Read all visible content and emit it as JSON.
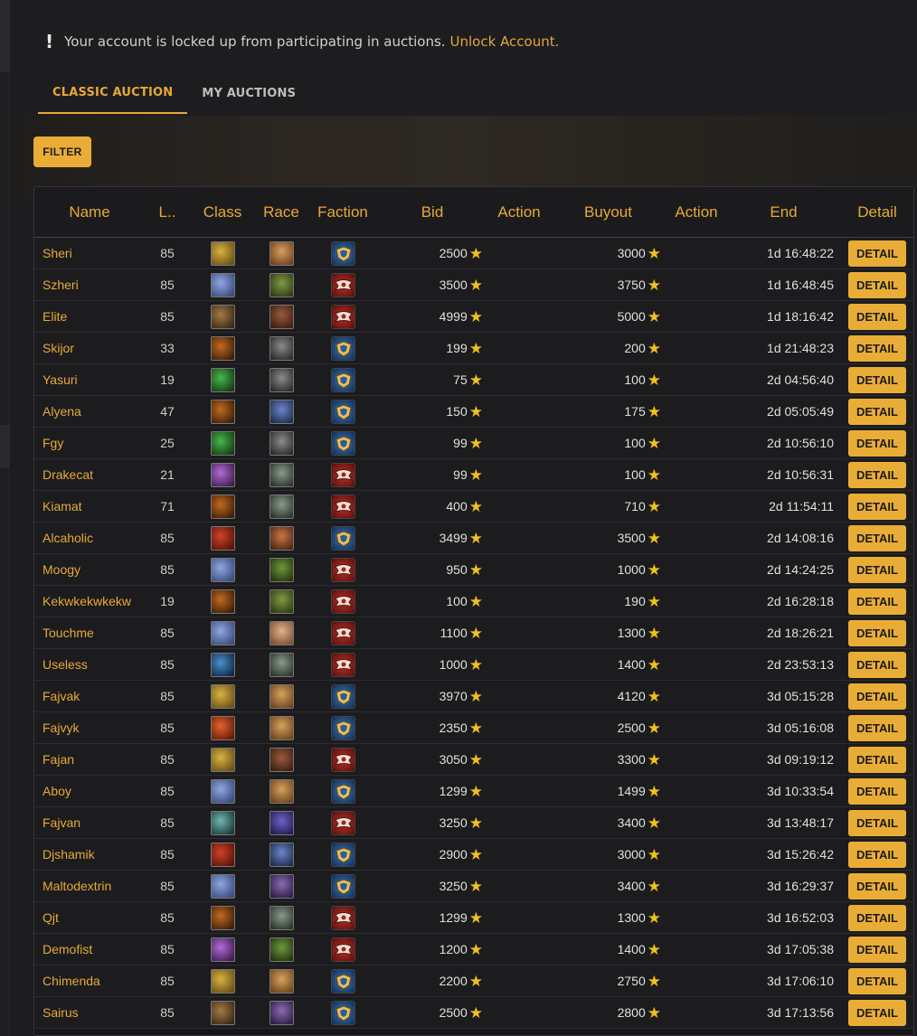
{
  "notice": {
    "text": "Your account is locked up from participating in auctions.",
    "link": "Unlock Account."
  },
  "tabs": [
    "CLASSIC AUCTION",
    "MY AUCTIONS"
  ],
  "filter_label": "FILTER",
  "columns": [
    "Name",
    "L..",
    "Class",
    "Race",
    "Faction",
    "Bid",
    "Action",
    "Buyout",
    "Action",
    "End",
    "Detail"
  ],
  "detail_label": "DETAIL",
  "colors": {
    "accent": "#e9ad37",
    "alliance": "#2f5c9b",
    "horde": "#9b2623"
  },
  "rows": [
    {
      "name": "Sheri",
      "level": "85",
      "class_icon": "paladin-icon",
      "race_icon": "human-female-icon",
      "faction": "alliance",
      "bid": "2500",
      "buyout": "3000",
      "end": "1d 16:48:22"
    },
    {
      "name": "Szheri",
      "level": "85",
      "class_icon": "priest-icon",
      "race_icon": "orc-male-icon",
      "faction": "horde",
      "bid": "3500",
      "buyout": "3750",
      "end": "1d 16:48:45"
    },
    {
      "name": "Elite",
      "level": "85",
      "class_icon": "druid-icon",
      "race_icon": "tauren-icon",
      "faction": "horde",
      "bid": "4999",
      "buyout": "5000",
      "end": "1d 18:16:42"
    },
    {
      "name": "Skijor",
      "level": "33",
      "class_icon": "hunter-icon",
      "race_icon": "worgen-icon",
      "faction": "alliance",
      "bid": "199",
      "buyout": "200",
      "end": "1d 21:48:23"
    },
    {
      "name": "Yasuri",
      "level": "19",
      "class_icon": "rogue-icon",
      "race_icon": "worgen-icon",
      "faction": "alliance",
      "bid": "75",
      "buyout": "100",
      "end": "2d 04:56:40"
    },
    {
      "name": "Alyena",
      "level": "47",
      "class_icon": "hunter-icon",
      "race_icon": "draenei-icon",
      "faction": "alliance",
      "bid": "150",
      "buyout": "175",
      "end": "2d 05:05:49"
    },
    {
      "name": "Fgy",
      "level": "25",
      "class_icon": "rogue-icon",
      "race_icon": "worgen-icon",
      "faction": "alliance",
      "bid": "99",
      "buyout": "100",
      "end": "2d 10:56:10"
    },
    {
      "name": "Drakecat",
      "level": "21",
      "class_icon": "warlock-icon",
      "race_icon": "undead-icon",
      "faction": "horde",
      "bid": "99",
      "buyout": "100",
      "end": "2d 10:56:31"
    },
    {
      "name": "Kiamat",
      "level": "71",
      "class_icon": "hunter-icon",
      "race_icon": "undead-icon",
      "faction": "horde",
      "bid": "400",
      "buyout": "710",
      "end": "2d 11:54:11"
    },
    {
      "name": "Alcaholic",
      "level": "85",
      "class_icon": "shaman-icon",
      "race_icon": "dwarf-icon",
      "faction": "alliance",
      "bid": "3499",
      "buyout": "3500",
      "end": "2d 14:08:16"
    },
    {
      "name": "Moogy",
      "level": "85",
      "class_icon": "priest-icon",
      "race_icon": "goblin-icon",
      "faction": "horde",
      "bid": "950",
      "buyout": "1000",
      "end": "2d 14:24:25"
    },
    {
      "name": "Kekwkekwkekw",
      "level": "19",
      "class_icon": "hunter-icon",
      "race_icon": "orc-male-icon",
      "faction": "horde",
      "bid": "100",
      "buyout": "190",
      "end": "2d 16:28:18"
    },
    {
      "name": "Touchme",
      "level": "85",
      "class_icon": "priest-icon",
      "race_icon": "blood-elf-icon",
      "faction": "horde",
      "bid": "1100",
      "buyout": "1300",
      "end": "2d 18:26:21"
    },
    {
      "name": "Useless",
      "level": "85",
      "class_icon": "warrior-icon",
      "race_icon": "undead-icon",
      "faction": "horde",
      "bid": "1000",
      "buyout": "1400",
      "end": "2d 23:53:13"
    },
    {
      "name": "Fajvak",
      "level": "85",
      "class_icon": "paladin-icon",
      "race_icon": "human-male-icon",
      "faction": "alliance",
      "bid": "3970",
      "buyout": "4120",
      "end": "3d 05:15:28"
    },
    {
      "name": "Fajvyk",
      "level": "85",
      "class_icon": "mage-icon",
      "race_icon": "human-male-icon",
      "faction": "alliance",
      "bid": "2350",
      "buyout": "2500",
      "end": "3d 05:16:08"
    },
    {
      "name": "Fajan",
      "level": "85",
      "class_icon": "paladin-icon",
      "race_icon": "tauren-icon",
      "faction": "horde",
      "bid": "3050",
      "buyout": "3300",
      "end": "3d 09:19:12"
    },
    {
      "name": "Aboy",
      "level": "85",
      "class_icon": "priest-icon",
      "race_icon": "human-male-icon",
      "faction": "alliance",
      "bid": "1299",
      "buyout": "1499",
      "end": "3d 10:33:54"
    },
    {
      "name": "Fajvan",
      "level": "85",
      "class_icon": "death-knight-icon",
      "race_icon": "troll-icon",
      "faction": "horde",
      "bid": "3250",
      "buyout": "3400",
      "end": "3d 13:48:17"
    },
    {
      "name": "Djshamik",
      "level": "85",
      "class_icon": "shaman-icon",
      "race_icon": "draenei-icon",
      "faction": "alliance",
      "bid": "2900",
      "buyout": "3000",
      "end": "3d 15:26:42"
    },
    {
      "name": "Maltodextrin",
      "level": "85",
      "class_icon": "priest-icon",
      "race_icon": "night-elf-icon",
      "faction": "alliance",
      "bid": "3250",
      "buyout": "3400",
      "end": "3d 16:29:37"
    },
    {
      "name": "Qjt",
      "level": "85",
      "class_icon": "hunter-icon",
      "race_icon": "undead-icon",
      "faction": "horde",
      "bid": "1299",
      "buyout": "1300",
      "end": "3d 16:52:03"
    },
    {
      "name": "Demofist",
      "level": "85",
      "class_icon": "warlock-icon",
      "race_icon": "goblin-icon",
      "faction": "horde",
      "bid": "1200",
      "buyout": "1400",
      "end": "3d 17:05:38"
    },
    {
      "name": "Chimenda",
      "level": "85",
      "class_icon": "paladin-icon",
      "race_icon": "human-male-icon",
      "faction": "alliance",
      "bid": "2200",
      "buyout": "2750",
      "end": "3d 17:06:10"
    },
    {
      "name": "Sairus",
      "level": "85",
      "class_icon": "druid-icon",
      "race_icon": "night-elf-icon",
      "faction": "alliance",
      "bid": "2500",
      "buyout": "2800",
      "end": "3d 17:13:56"
    }
  ]
}
